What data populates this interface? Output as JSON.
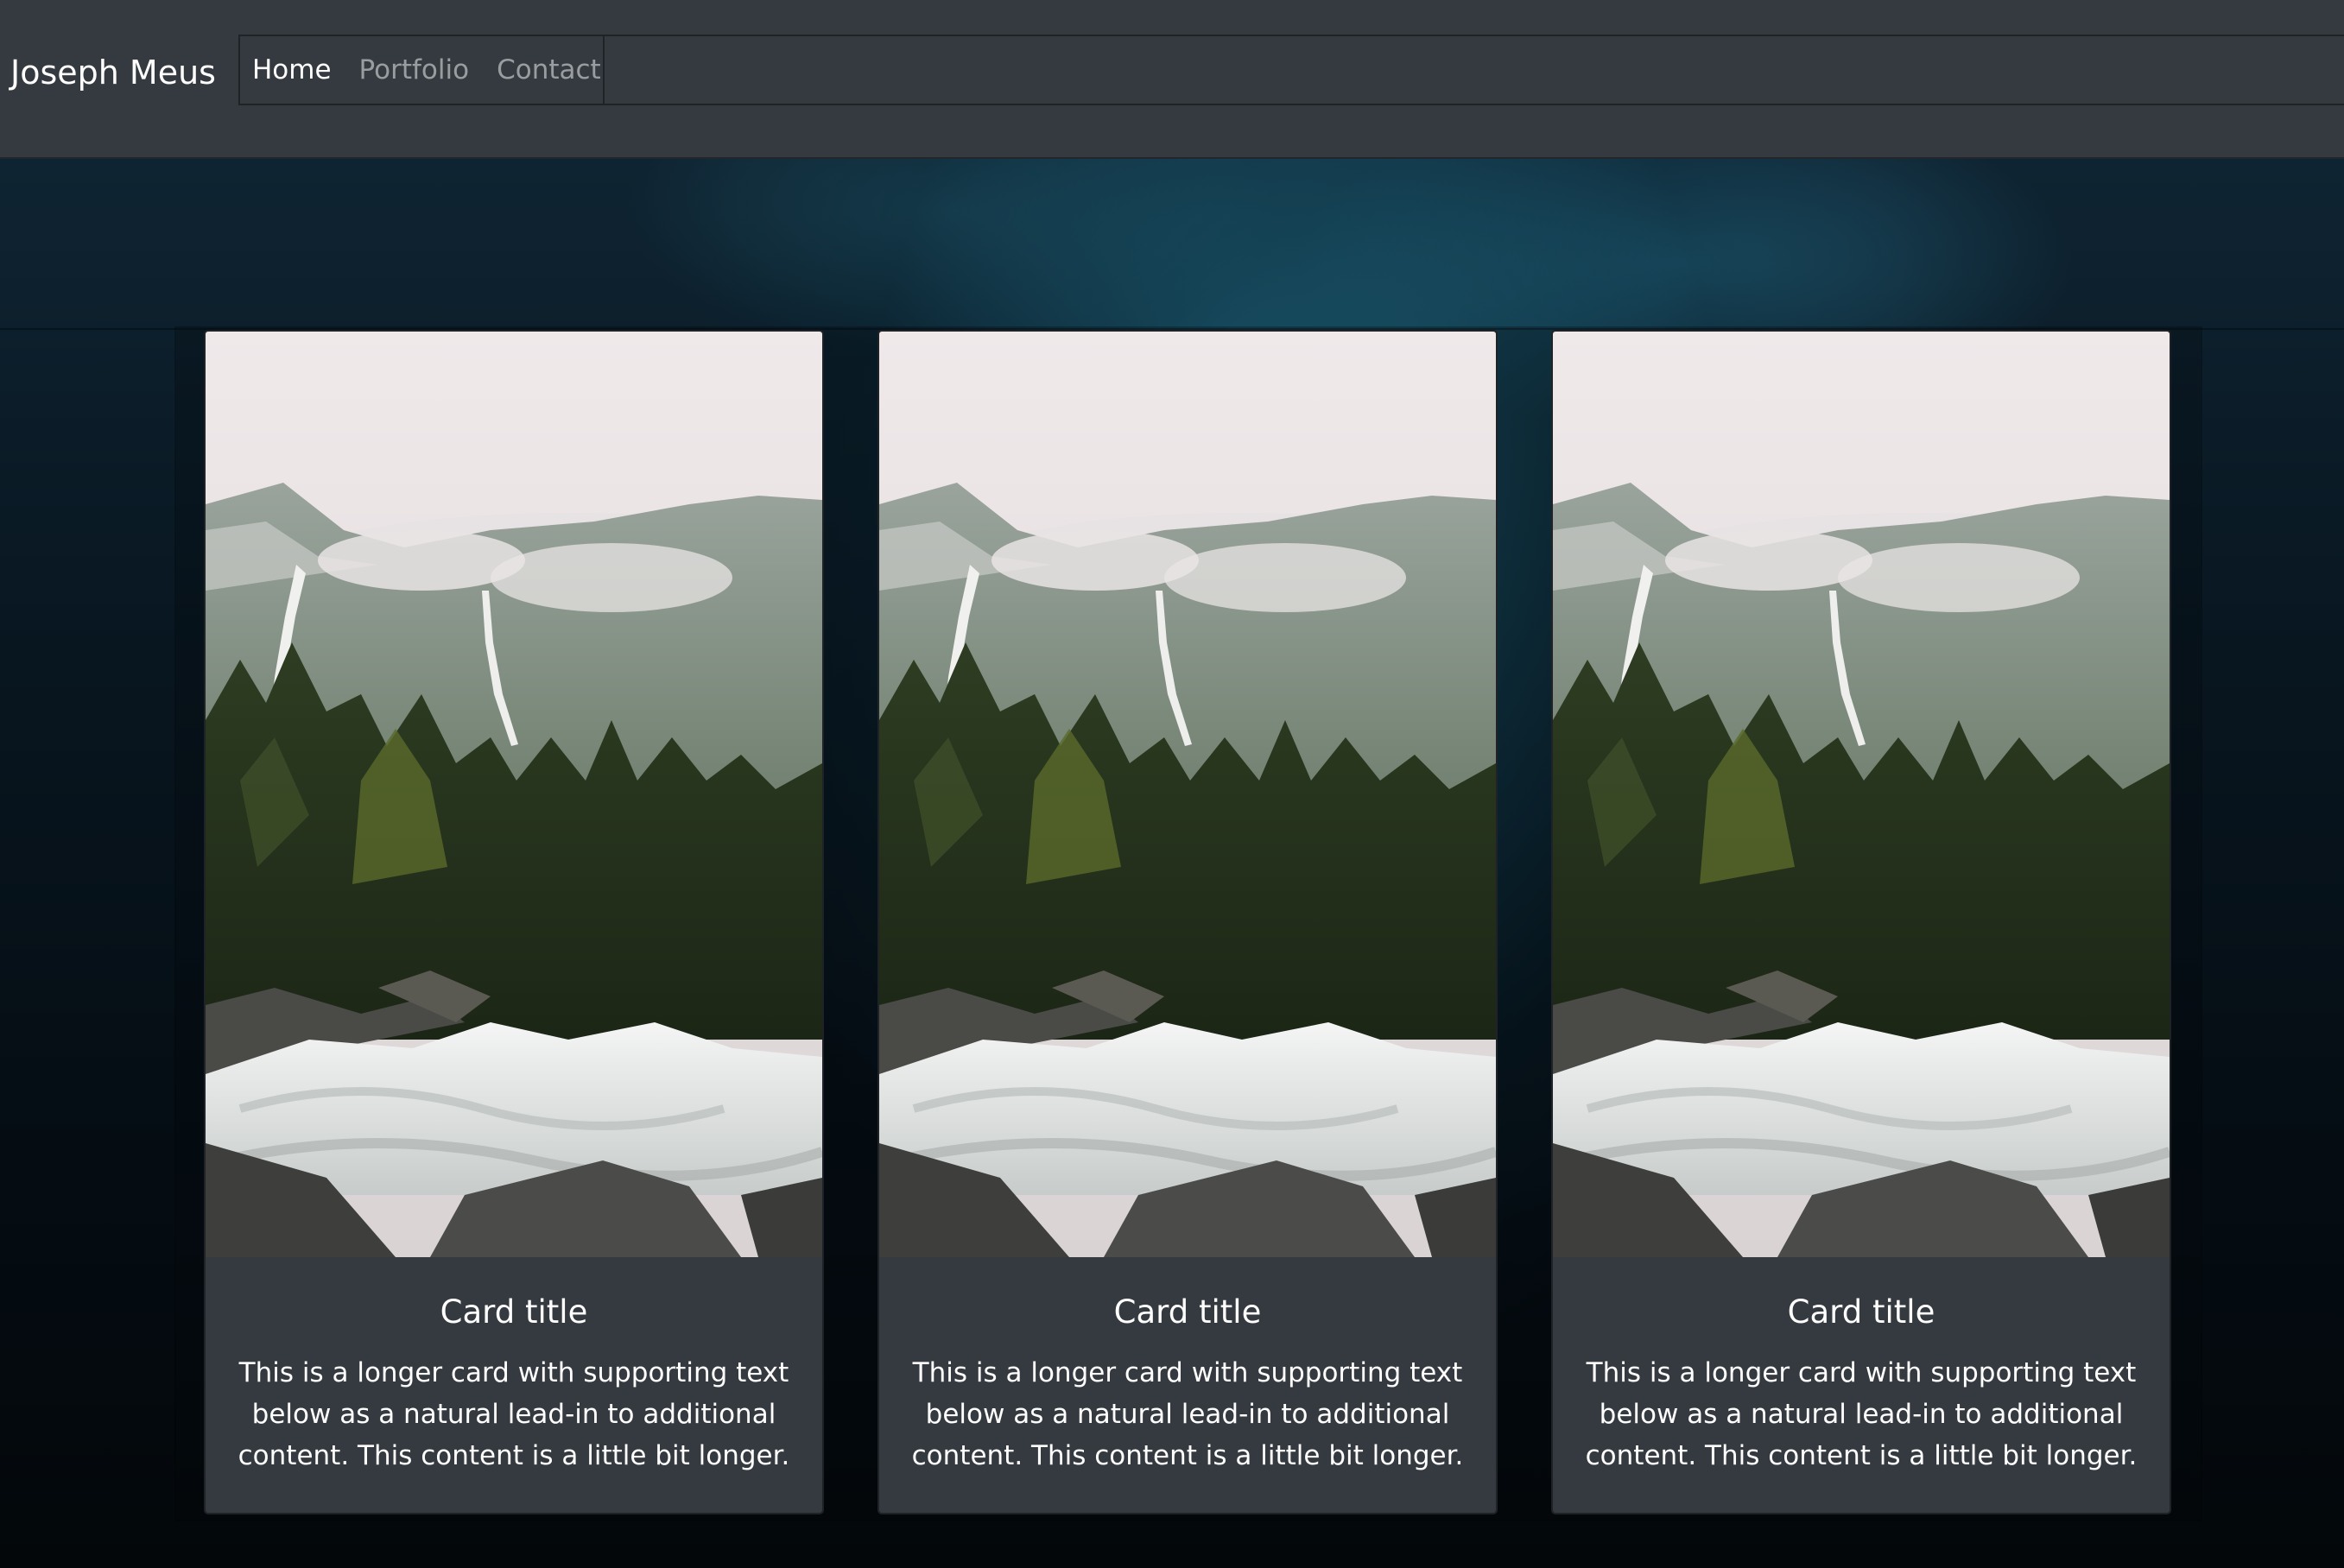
{
  "navbar": {
    "brand": "Joseph Meus",
    "links": [
      {
        "label": "Home",
        "active": true
      },
      {
        "label": "Portfolio",
        "active": false
      },
      {
        "label": "Contact",
        "active": false
      }
    ]
  },
  "cards": [
    {
      "title": "Card title",
      "text": "This is a longer card with supporting text below as a natural lead-in to additional content. This content is a little bit longer."
    },
    {
      "title": "Card title",
      "text": "This is a longer card with supporting text below as a natural lead-in to additional content. This content is a little bit longer."
    },
    {
      "title": "Card title",
      "text": "This is a longer card with supporting text below as a natural lead-in to additional content. This content is a little bit longer."
    }
  ],
  "colors": {
    "navbar_bg": "#343a40",
    "card_bg": "#343a40",
    "hero_accent": "#1e6982"
  }
}
